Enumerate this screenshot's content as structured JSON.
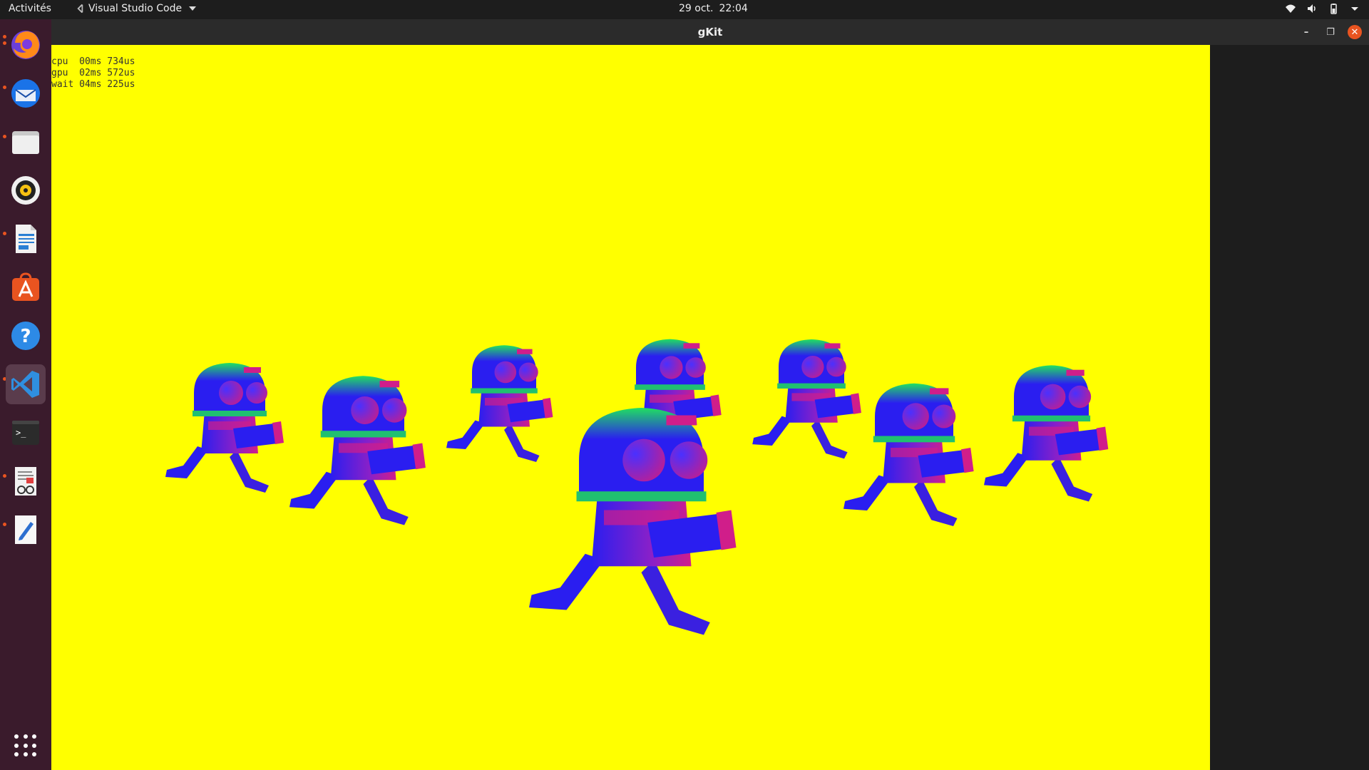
{
  "topbar": {
    "activities": "Activités",
    "app_name": "Visual Studio Code",
    "date": "29 oct.",
    "time": "22:04"
  },
  "window": {
    "title": "gKit",
    "stats": [
      "cpu  00ms 734us",
      "gpu  02ms 572us",
      "wait 04ms 225us"
    ]
  },
  "dock": {
    "items": [
      "firefox-icon",
      "thunderbird-icon",
      "files-icon",
      "rhythmbox-icon",
      "writer-icon",
      "app-center-icon",
      "help-icon",
      "vscode-icon",
      "terminal-icon",
      "document-viewer-icon",
      "text-editor-icon"
    ],
    "active": "vscode-icon",
    "show_apps": "apps-grid-icon"
  },
  "colors": {
    "viewport_bg": "#ffff00",
    "robot_blue": "#2a1ef0",
    "robot_magenta": "#c8208c",
    "robot_green": "#20e060",
    "accent": "#e95420"
  }
}
